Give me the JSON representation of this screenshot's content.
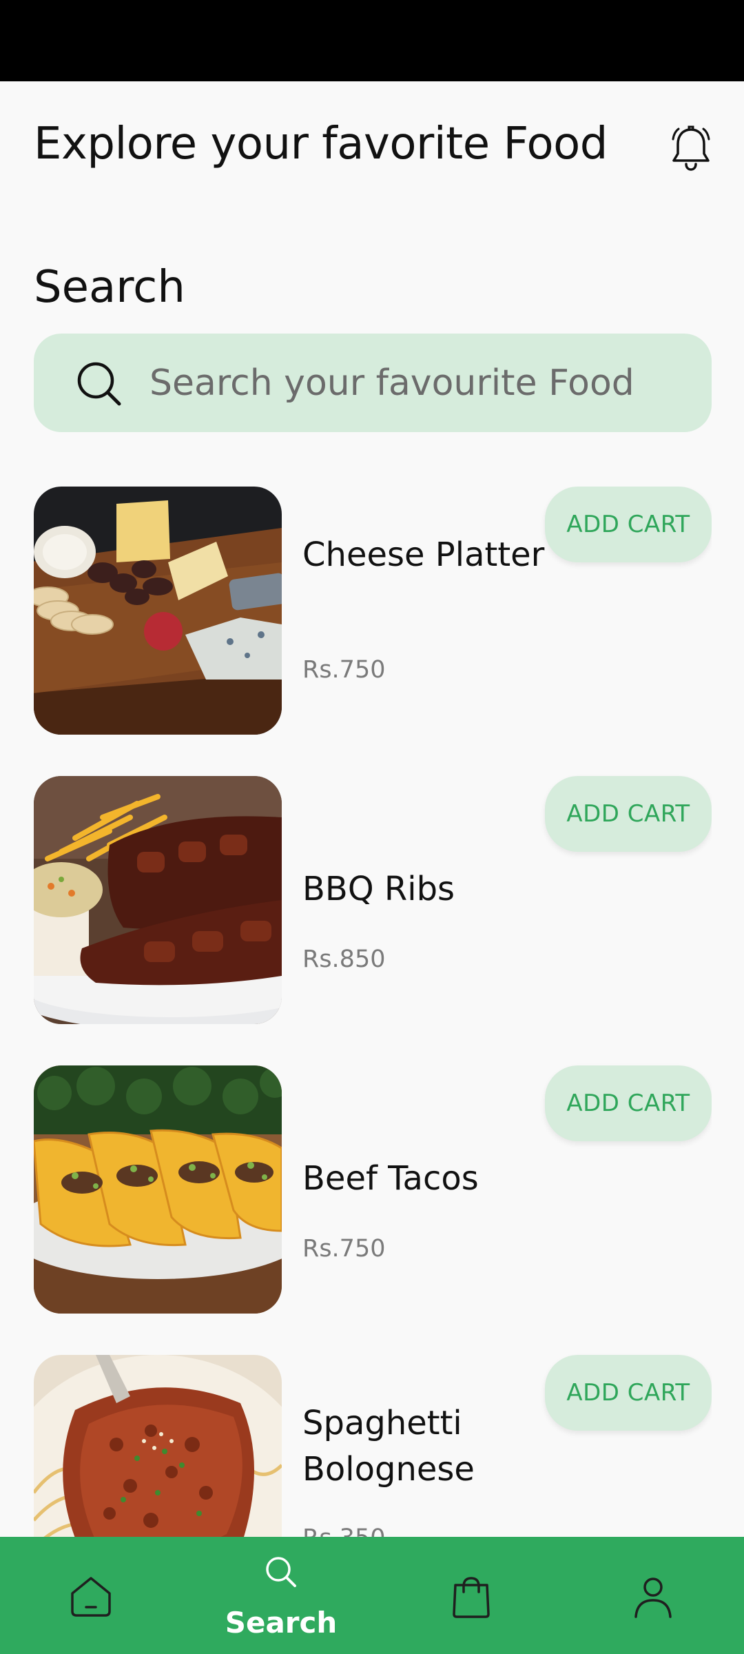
{
  "header": {
    "title": "Explore your favorite Food"
  },
  "section": {
    "title": "Search"
  },
  "search": {
    "placeholder": "Search your favourite Food",
    "value": ""
  },
  "foods": [
    {
      "name": "Cheese Platter",
      "price": "Rs.750",
      "button": "ADD CART"
    },
    {
      "name": "BBQ Ribs",
      "price": "Rs.850",
      "button": "ADD CART"
    },
    {
      "name": "Beef Tacos",
      "price": "Rs.750",
      "button": "ADD CART"
    },
    {
      "name": "Spaghetti Bolognese",
      "price": "Rs.350",
      "button": "ADD CART"
    }
  ],
  "nav": {
    "items": [
      {
        "icon": "home-icon",
        "label": ""
      },
      {
        "icon": "search-icon",
        "label": "Search",
        "active": true
      },
      {
        "icon": "shopping-bag-icon",
        "label": ""
      },
      {
        "icon": "profile-icon",
        "label": ""
      }
    ]
  },
  "colors": {
    "accent": "#2faa5e",
    "accent_light": "#d6ecdc",
    "background": "#f9f9f9",
    "status_bar": "#000000"
  }
}
